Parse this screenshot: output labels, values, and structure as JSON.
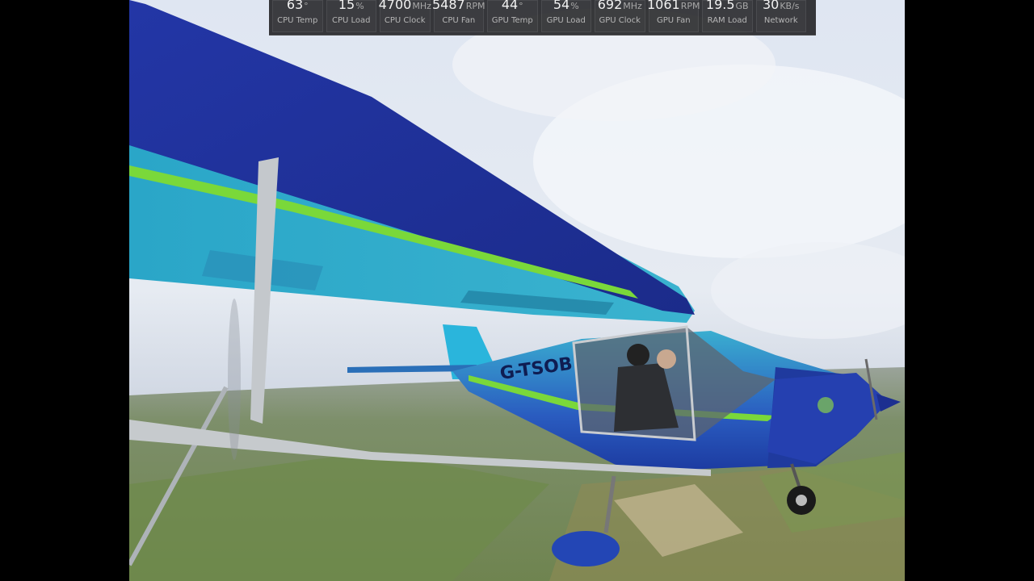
{
  "hud": {
    "metrics": [
      {
        "value": "63",
        "unit": "°",
        "label": "CPU Temp"
      },
      {
        "value": "15",
        "unit": "%",
        "label": "CPU Load"
      },
      {
        "value": "4700",
        "unit": "MHz",
        "label": "CPU Clock"
      },
      {
        "value": "5487",
        "unit": "RPM",
        "label": "CPU Fan"
      },
      {
        "value": "44",
        "unit": "°",
        "label": "GPU Temp"
      },
      {
        "value": "54",
        "unit": "%",
        "label": "GPU Load"
      },
      {
        "value": "692",
        "unit": "MHz",
        "label": "GPU Clock"
      },
      {
        "value": "1061",
        "unit": "RPM",
        "label": "GPU Fan"
      },
      {
        "value": "19.5",
        "unit": "GB",
        "label": "RAM Load"
      },
      {
        "value": "30",
        "unit": "KB/s",
        "label": "Network"
      }
    ]
  },
  "video": {
    "registration": "G-TSOB"
  }
}
